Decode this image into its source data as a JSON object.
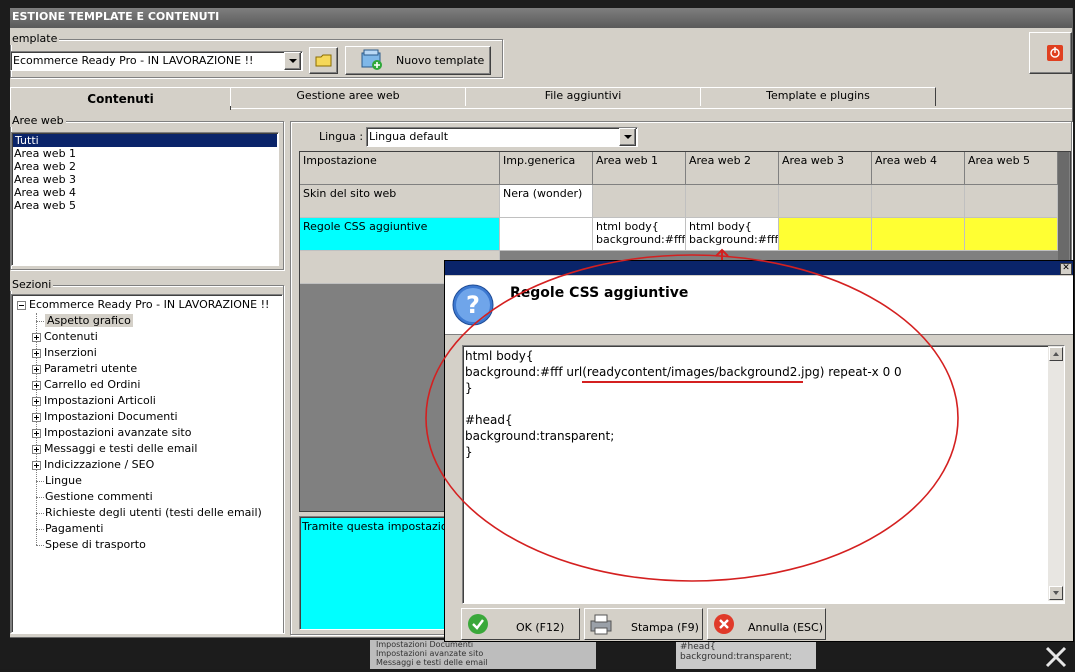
{
  "window": {
    "title": "ESTIONE TEMPLATE E CONTENUTI"
  },
  "template_group": {
    "label": "emplate",
    "combo_value": "Ecommerce Ready Pro - IN LAVORAZIONE !!",
    "new_template_label": "Nuovo template"
  },
  "tabs": [
    {
      "label": "Contenuti",
      "active": true
    },
    {
      "label": "Gestione aree web",
      "active": false
    },
    {
      "label": "File aggiuntivi",
      "active": false
    },
    {
      "label": "Template e plugins",
      "active": false
    }
  ],
  "aree_web": {
    "label": "Aree web",
    "items": [
      "Tutti",
      "Area web 1",
      "Area web 2",
      "Area web 3",
      "Area web 4",
      "Area web 5"
    ],
    "selected": "Tutti"
  },
  "sezioni": {
    "label": "Sezioni",
    "root": "Ecommerce Ready Pro - IN LAVORAZIONE !!",
    "items": [
      {
        "label": "Aspetto grafico",
        "expandable": false,
        "selected": true
      },
      {
        "label": "Contenuti",
        "expandable": true
      },
      {
        "label": "Inserzioni",
        "expandable": true
      },
      {
        "label": "Parametri utente",
        "expandable": true
      },
      {
        "label": "Carrello ed Ordini",
        "expandable": true
      },
      {
        "label": "Impostazioni Articoli",
        "expandable": true
      },
      {
        "label": "Impostazioni Documenti",
        "expandable": true
      },
      {
        "label": "Impostazioni avanzate sito",
        "expandable": true
      },
      {
        "label": "Messaggi e testi delle email",
        "expandable": true
      },
      {
        "label": "Indicizzazione / SEO",
        "expandable": true
      },
      {
        "label": "Lingue",
        "expandable": false
      },
      {
        "label": "Gestione commenti",
        "expandable": false
      },
      {
        "label": "Richieste degli utenti (testi delle email)",
        "expandable": false
      },
      {
        "label": "Pagamenti",
        "expandable": false
      },
      {
        "label": "Spese di trasporto",
        "expandable": false
      }
    ]
  },
  "lingua": {
    "label": "Lingua :",
    "value": "Lingua default"
  },
  "grid": {
    "columns": [
      "Impostazione",
      "Imp.generica",
      "Area web 1",
      "Area web 2",
      "Area web 3",
      "Area web 4",
      "Area web 5"
    ],
    "rows": [
      {
        "cells": [
          "Skin del sito web",
          "Nera (wonder)",
          "",
          "",
          "",
          "",
          ""
        ]
      },
      {
        "cells": [
          "Regole CSS aggiuntive",
          "",
          "html body{\nbackground:#fff",
          "html body{\nbackground:#fff",
          "",
          "",
          ""
        ]
      }
    ]
  },
  "description_text": "Tramite questa impostazione e",
  "dialog": {
    "title": "Regole CSS aggiuntive",
    "code_lines": [
      "html body{",
      "background:#fff url(readycontent/images/background2.jpg) repeat-x 0 0",
      "}",
      "",
      "#head{",
      "background:transparent;",
      "}"
    ],
    "buttons": {
      "ok": "OK (F12)",
      "print": "Stampa (F9)",
      "cancel": "Annulla (ESC)"
    }
  },
  "bg_peek": {
    "lines": [
      "Impostazioni Documenti",
      "Impostazioni avanzate sito",
      "Messaggi e testi delle email"
    ],
    "code_lines": [
      "#head{",
      "background:transparent;"
    ]
  },
  "colors": {
    "cyan": "#00ffff",
    "yellow": "#ffff33",
    "selection": "#0a246a",
    "annotation_red": "#d42020"
  }
}
